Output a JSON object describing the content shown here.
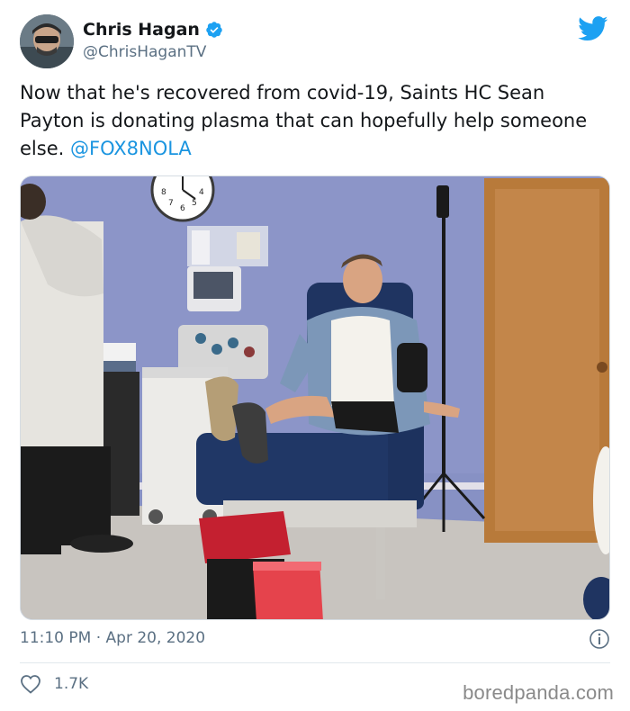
{
  "author": {
    "name": "Chris Hagan",
    "handle": "@ChrisHaganTV",
    "verified": true
  },
  "tweet": {
    "text": "Now that he's recovered from covid-19, Saints HC Sean Payton is donating plasma that can hopefully help someone else.",
    "mention": "@FOX8NOLA"
  },
  "photo": {
    "clock_digits": [
      "8",
      "7",
      "6",
      "5",
      "4"
    ]
  },
  "meta": {
    "timestamp": "11:10 PM · Apr 20, 2020"
  },
  "engagement": {
    "likes": "1.7K"
  },
  "watermark": "boredpanda.com",
  "icons": {
    "verified": "verified-badge-icon",
    "platform": "twitter-bird-icon",
    "info": "info-icon",
    "like": "heart-icon"
  },
  "colors": {
    "twitter_blue": "#1da1f2",
    "link_blue": "#1b95e0",
    "muted_text": "#5b7083"
  }
}
